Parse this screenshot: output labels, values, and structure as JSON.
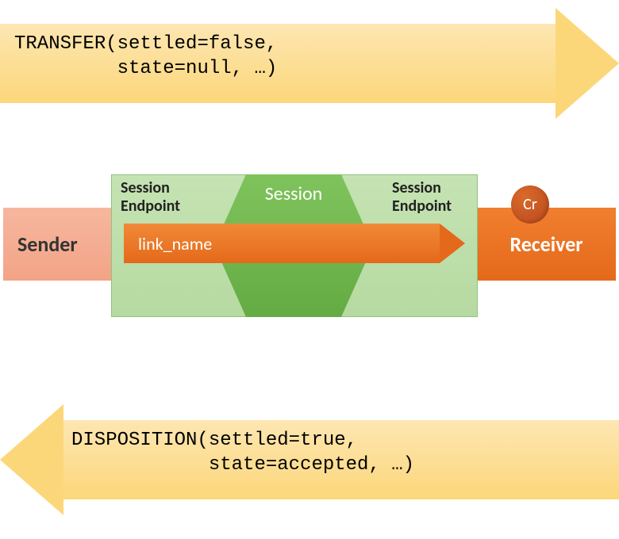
{
  "top_arrow": {
    "label": "TRANSFER(settled=false,\n         state=null, …)",
    "direction": "right",
    "performative": "TRANSFER",
    "params": {
      "settled": "false",
      "state": "null",
      "rest": "…"
    }
  },
  "middle": {
    "sender_label": "Sender",
    "receiver_label": "Receiver",
    "session_label": "Session",
    "endpoint_left_label": "Session\nEndpoint",
    "endpoint_right_label": "Session\nEndpoint",
    "link_arrow_label": "link_name",
    "cr_badge_label": "Cr"
  },
  "bottom_arrow": {
    "label": "DISPOSITION(settled=true,\n            state=accepted, …)",
    "direction": "left",
    "performative": "DISPOSITION",
    "params": {
      "settled": "true",
      "state": "accepted",
      "rest": "…"
    }
  },
  "colors": {
    "arrow_fill": "#fcd77a",
    "sender_fill": "#f3a386",
    "receiver_fill": "#e5691a",
    "session_outer": "#b6daa1",
    "session_inner": "#64ab43",
    "link_fill": "#e5691a",
    "cr_fill": "#b8471b"
  }
}
